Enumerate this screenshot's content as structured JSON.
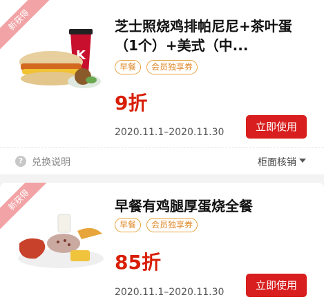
{
  "coupons": [
    {
      "ribbon": "新获得",
      "title": "芝士照烧鸡排帕尼尼+茶叶蛋（1个）+美式（中...",
      "tags": [
        "早餐",
        "会员独享券"
      ],
      "discount": "9折",
      "validity": "2020.11.1–2020.11.30",
      "action": "立即使用"
    },
    {
      "ribbon": "新获得",
      "title": "早餐有鸡腿厚蛋烧全餐",
      "tags": [
        "早餐",
        "会员独享券"
      ],
      "discount": "85折",
      "validity": "2020.11.1–2020.11.30",
      "action": "立即使用"
    }
  ],
  "info_bar": {
    "help_label": "兑换说明",
    "redeem_label": "柜面核销"
  },
  "colors": {
    "accent": "#d81e06",
    "button": "#d81e1e",
    "tag": "#e0892b",
    "ribbon": "#f2a3a5"
  },
  "icons": {
    "help": "question-circle-icon",
    "expand": "chevron-down-icon"
  }
}
